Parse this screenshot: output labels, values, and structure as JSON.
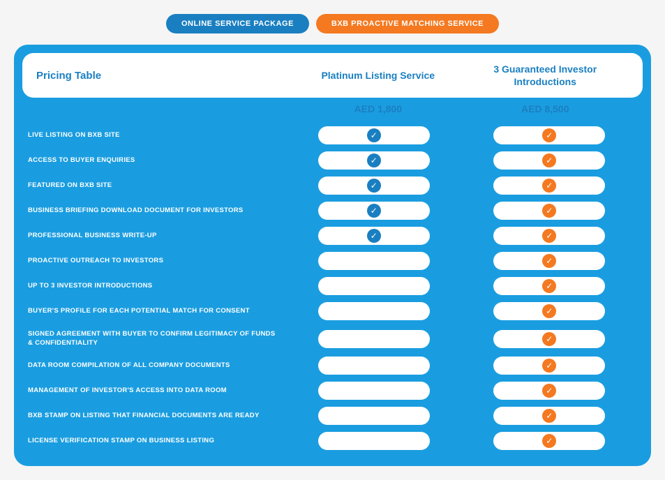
{
  "tabs": [
    {
      "id": "online",
      "label": "ONLINE SERVICE PACKAGE",
      "style": "active-blue"
    },
    {
      "id": "bxb",
      "label": "BXB PROACTIVE MATCHING SERVICE",
      "style": "active-orange"
    }
  ],
  "header": {
    "pricing_table_label": "Pricing Table",
    "col1_label": "Platinum Listing Service",
    "col2_label": "3 Guaranteed Investor Introductions"
  },
  "prices": {
    "col1": "AED 1,800",
    "col2": "AED 8,500"
  },
  "features": [
    {
      "label": "LIVE LISTING ON BXB SITE",
      "col1_check": true,
      "col1_type": "blue",
      "col2_check": true,
      "col2_type": "orange"
    },
    {
      "label": "ACCESS TO BUYER ENQUIRIES",
      "col1_check": true,
      "col1_type": "blue",
      "col2_check": true,
      "col2_type": "orange"
    },
    {
      "label": "FEATURED ON BXB SITE",
      "col1_check": true,
      "col1_type": "blue",
      "col2_check": true,
      "col2_type": "orange"
    },
    {
      "label": "BUSINESS BRIEFING DOWNLOAD DOCUMENT FOR INVESTORS",
      "col1_check": true,
      "col1_type": "blue",
      "col2_check": true,
      "col2_type": "orange"
    },
    {
      "label": "PROFESSIONAL BUSINESS WRITE-UP",
      "col1_check": true,
      "col1_type": "blue",
      "col2_check": true,
      "col2_type": "orange"
    },
    {
      "label": "PROACTIVE OUTREACH TO INVESTORS",
      "col1_check": false,
      "col2_check": true,
      "col2_type": "orange"
    },
    {
      "label": "UP TO 3 INVESTOR INTRODUCTIONS",
      "col1_check": false,
      "col2_check": true,
      "col2_type": "orange"
    },
    {
      "label": "BUYER'S PROFILE FOR EACH POTENTIAL MATCH FOR CONSENT",
      "col1_check": false,
      "col2_check": true,
      "col2_type": "orange"
    },
    {
      "label": "SIGNED AGREEMENT WITH BUYER TO CONFIRM LEGITIMACY OF FUNDS & CONFIDENTIALITY",
      "col1_check": false,
      "col2_check": true,
      "col2_type": "orange",
      "multiline": true
    },
    {
      "label": "DATA ROOM COMPILATION OF ALL COMPANY DOCUMENTS",
      "col1_check": false,
      "col2_check": true,
      "col2_type": "orange"
    },
    {
      "label": "MANAGEMENT OF INVESTOR'S ACCESS INTO DATA ROOM",
      "col1_check": false,
      "col2_check": true,
      "col2_type": "orange"
    },
    {
      "label": "BXB STAMP ON LISTING THAT FINANCIAL DOCUMENTS ARE READY",
      "col1_check": false,
      "col2_check": true,
      "col2_type": "orange"
    },
    {
      "label": "LICENSE VERIFICATION STAMP ON BUSINESS LISTING",
      "col1_check": false,
      "col2_check": true,
      "col2_type": "orange"
    }
  ],
  "checkmark": "✓"
}
